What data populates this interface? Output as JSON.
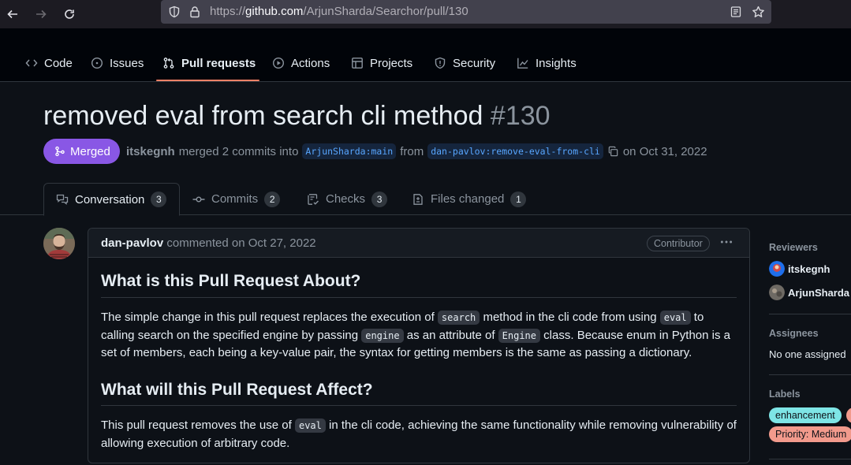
{
  "browser": {
    "url_prefix": "https://",
    "url_host": "github.com",
    "url_path": "/ArjunSharda/Searchor/pull/130"
  },
  "repo_nav": {
    "tabs": [
      {
        "label": "Code",
        "icon": "code-icon"
      },
      {
        "label": "Issues",
        "icon": "issue-icon"
      },
      {
        "label": "Pull requests",
        "icon": "pull-request-icon",
        "selected": true
      },
      {
        "label": "Actions",
        "icon": "play-icon"
      },
      {
        "label": "Projects",
        "icon": "table-icon"
      },
      {
        "label": "Security",
        "icon": "shield-icon"
      },
      {
        "label": "Insights",
        "icon": "graph-icon"
      }
    ]
  },
  "pr": {
    "title": "removed eval from search cli method",
    "number": "#130",
    "state": "Merged",
    "author": "itskegnh",
    "merged_text": "merged 2 commits into",
    "base_branch": "ArjunSharda:main",
    "from_text": "from",
    "head_branch": "dan-pavlov:remove-eval-from-cli",
    "date_text": "on Oct 31, 2022"
  },
  "pr_tabs": [
    {
      "label": "Conversation",
      "count": "3",
      "icon": "comment-discussion-icon"
    },
    {
      "label": "Commits",
      "count": "2",
      "icon": "git-commit-icon"
    },
    {
      "label": "Checks",
      "count": "3",
      "icon": "checklist-icon"
    },
    {
      "label": "Files changed",
      "count": "1",
      "icon": "file-diff-icon"
    }
  ],
  "comment": {
    "author": "dan-pavlov",
    "commented": "commented on Oct 27, 2022",
    "badge": "Contributor",
    "heading1": "What is this Pull Request About?",
    "p1_a": "The simple change in this pull request replaces the execution of ",
    "p1_code1": "search",
    "p1_b": " method in the cli code from using ",
    "p1_code2": "eval",
    "p1_c": " to calling search on the specified engine by passing ",
    "p1_code3": "engine",
    "p1_d": " as an attribute of ",
    "p1_code4": "Engine",
    "p1_e": " class. Because enum in Python is a set of members, each being a key-value pair, the syntax for getting members is the same as passing a dictionary.",
    "heading2": "What will this Pull Request Affect?",
    "p2_a": "This pull request removes the use of ",
    "p2_code1": "eval",
    "p2_b": " in the cli code, achieving the same functionality while removing vulnerability of allowing execution of arbitrary code."
  },
  "sidebar": {
    "reviewers_heading": "Reviewers",
    "reviewers": [
      "itskegnh",
      "ArjunSharda"
    ],
    "assignees_heading": "Assignees",
    "assignees_text": "No one assigned",
    "labels_heading": "Labels",
    "labels": [
      {
        "name": "enhancement",
        "bg": "#7ee5e6",
        "fg": "#0d1117"
      },
      {
        "name": "Priority: Medium",
        "bg": "#f29a8c",
        "fg": "#0d1117"
      }
    ]
  },
  "colors": {
    "accent": "#f78166",
    "merged": "#8957e5",
    "link": "#58a6ff"
  }
}
